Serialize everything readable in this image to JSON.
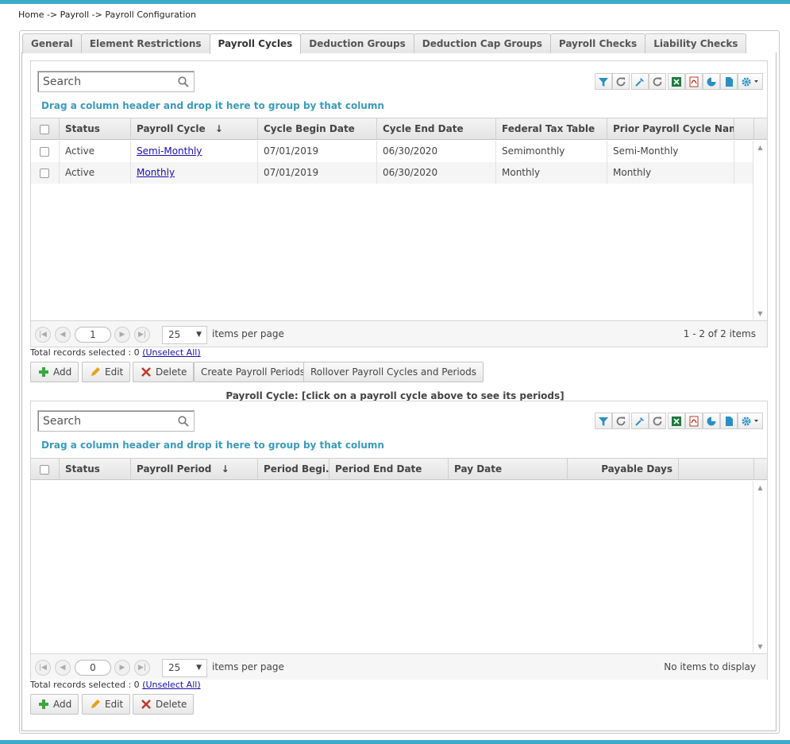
{
  "breadcrumb": "Home -> Payroll -> Payroll Configuration",
  "tabs": [
    "General",
    "Element Restrictions",
    "Payroll Cycles",
    "Deduction Groups",
    "Deduction Cap Groups",
    "Payroll Checks",
    "Liability Checks"
  ],
  "active_tab": "Payroll Cycles",
  "cycles_grid": {
    "search_placeholder": "Search",
    "group_hint": "Drag a column header and drop it here to group by that column",
    "columns": [
      "Status",
      "Payroll Cycle",
      "Cycle Begin Date",
      "Cycle End Date",
      "Federal Tax Table",
      "Prior Payroll Cycle Name"
    ],
    "sort_indicator": "↓",
    "rows": [
      {
        "status": "Active",
        "cycle": "Semi-Monthly",
        "begin": "07/01/2019",
        "end": "06/30/2020",
        "tax": "Semimonthly",
        "prior": "Semi-Monthly"
      },
      {
        "status": "Active",
        "cycle": "Monthly",
        "begin": "07/01/2019",
        "end": "06/30/2020",
        "tax": "Monthly",
        "prior": "Monthly"
      }
    ],
    "page": "1",
    "page_size": "25",
    "items_per_page": "items per page",
    "page_info": "1 - 2 of 2 items",
    "selected_label": "Total records selected : 0",
    "unselect_all": "(Unselect All)"
  },
  "cycles_actions": {
    "add": "Add",
    "edit": "Edit",
    "delete": "Delete",
    "create_periods": "Create Payroll Periods",
    "rollover": "Rollover Payroll Cycles and Periods"
  },
  "periods_caption": "Payroll Cycle: [click on a payroll cycle above to see its periods]",
  "periods_grid": {
    "search_placeholder": "Search",
    "group_hint": "Drag a column header and drop it here to group by that column",
    "columns": [
      "Status",
      "Payroll Period",
      "Period Begi...",
      "Period End Date",
      "Pay Date",
      "Payable Days"
    ],
    "sort_indicator": "↓",
    "page": "0",
    "page_size": "25",
    "items_per_page": "items per page",
    "page_info": "No items to display",
    "selected_label": "Total records selected : 0",
    "unselect_all": "(Unselect All)"
  },
  "periods_actions": {
    "add": "Add",
    "edit": "Edit",
    "delete": "Delete"
  },
  "colors": {
    "accent": "#3fa9c8",
    "group_hint": "#3c9ab8",
    "link": "#1a0dab",
    "filter_icon": "#2a8fc4",
    "excel_icon": "#1e7a3c",
    "pdf_icon": "#c0392b",
    "add_icon": "#3aa83a",
    "delete_icon": "#c0392b",
    "edit_icon": "#e6a21a"
  },
  "toolbar_icons": [
    "filter-icon",
    "refresh-icon",
    "wrench-icon",
    "reload-icon",
    "excel-icon",
    "pdf-icon",
    "chart-icon",
    "document-icon",
    "settings-icon"
  ]
}
